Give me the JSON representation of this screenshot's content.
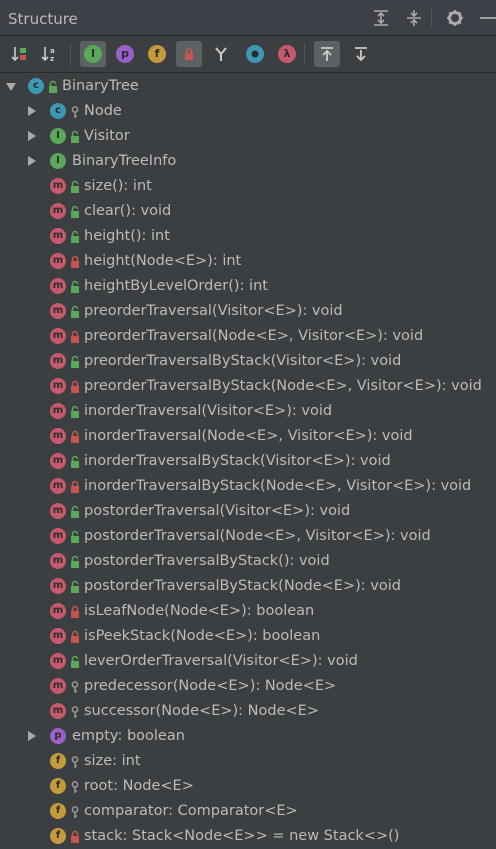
{
  "header": {
    "title": "Structure"
  },
  "toolbar": {
    "buttons": [
      {
        "name": "sort-by-visibility-button",
        "glyph": "↓",
        "active": false
      },
      {
        "name": "sort-alphabetically-button",
        "glyph": "↓",
        "active": false
      },
      {
        "name": "show-inherited-button",
        "glyph": "I",
        "active": true
      },
      {
        "name": "show-properties-button",
        "glyph": "p",
        "active": false
      },
      {
        "name": "show-fields-button",
        "glyph": "f",
        "active": false
      },
      {
        "name": "show-non-public-button",
        "glyph": "",
        "active": true
      },
      {
        "name": "show-anonymous-button",
        "glyph": "Y",
        "active": false
      },
      {
        "name": "show-lambdas-button",
        "glyph": "",
        "active": false
      },
      {
        "name": "show-lambda-button",
        "glyph": "λ",
        "active": false
      },
      {
        "name": "autoscroll-to-source-button",
        "glyph": "",
        "active": true
      },
      {
        "name": "autoscroll-from-source-button",
        "glyph": "",
        "active": false
      }
    ]
  },
  "tree": {
    "items": [
      {
        "label": "BinaryTree",
        "kind": "c",
        "vis": "public",
        "expand": "down",
        "level": 0
      },
      {
        "label": "Node",
        "kind": "c",
        "vis": "package",
        "expand": "right",
        "level": 1
      },
      {
        "label": "Visitor",
        "kind": "i",
        "vis": "public",
        "expand": "right",
        "level": 1
      },
      {
        "label": "BinaryTreeInfo",
        "kind": "i",
        "vis": "none",
        "expand": "right",
        "level": 1
      },
      {
        "label": "size(): int",
        "kind": "m",
        "vis": "public",
        "expand": "none",
        "level": 1
      },
      {
        "label": "clear(): void",
        "kind": "m",
        "vis": "public",
        "expand": "none",
        "level": 1
      },
      {
        "label": "height(): int",
        "kind": "m",
        "vis": "public",
        "expand": "none",
        "level": 1
      },
      {
        "label": "height(Node<E>): int",
        "kind": "m",
        "vis": "private",
        "expand": "none",
        "level": 1
      },
      {
        "label": "heightByLevelOrder(): int",
        "kind": "m",
        "vis": "public",
        "expand": "none",
        "level": 1
      },
      {
        "label": "preorderTraversal(Visitor<E>): void",
        "kind": "m",
        "vis": "public",
        "expand": "none",
        "level": 1
      },
      {
        "label": "preorderTraversal(Node<E>, Visitor<E>): void",
        "kind": "m",
        "vis": "private",
        "expand": "none",
        "level": 1
      },
      {
        "label": "preorderTraversalByStack(Visitor<E>): void",
        "kind": "m",
        "vis": "public",
        "expand": "none",
        "level": 1
      },
      {
        "label": "preorderTraversalByStack(Node<E>, Visitor<E>): void",
        "kind": "m",
        "vis": "private",
        "expand": "none",
        "level": 1
      },
      {
        "label": "inorderTraversal(Visitor<E>): void",
        "kind": "m",
        "vis": "public",
        "expand": "none",
        "level": 1
      },
      {
        "label": "inorderTraversal(Node<E>, Visitor<E>): void",
        "kind": "m",
        "vis": "private",
        "expand": "none",
        "level": 1
      },
      {
        "label": "inorderTraversalByStack(Visitor<E>): void",
        "kind": "m",
        "vis": "public",
        "expand": "none",
        "level": 1
      },
      {
        "label": "inorderTraversalByStack(Node<E>, Visitor<E>): void",
        "kind": "m",
        "vis": "private",
        "expand": "none",
        "level": 1
      },
      {
        "label": "postorderTraversal(Visitor<E>): void",
        "kind": "m",
        "vis": "public",
        "expand": "none",
        "level": 1
      },
      {
        "label": "postorderTraversal(Node<E>, Visitor<E>): void",
        "kind": "m",
        "vis": "public",
        "expand": "none",
        "level": 1
      },
      {
        "label": "postorderTraversalByStack(): void",
        "kind": "m",
        "vis": "public",
        "expand": "none",
        "level": 1
      },
      {
        "label": "postorderTraversalByStack(Node<E>): void",
        "kind": "m",
        "vis": "public",
        "expand": "none",
        "level": 1
      },
      {
        "label": "isLeafNode(Node<E>): boolean",
        "kind": "m",
        "vis": "private",
        "expand": "none",
        "level": 1
      },
      {
        "label": "isPeekStack(Node<E>): boolean",
        "kind": "m",
        "vis": "private",
        "expand": "none",
        "level": 1
      },
      {
        "label": "leverOrderTraversal(Visitor<E>): void",
        "kind": "m",
        "vis": "public",
        "expand": "none",
        "level": 1
      },
      {
        "label": "predecessor(Node<E>): Node<E>",
        "kind": "m",
        "vis": "package",
        "expand": "none",
        "level": 1
      },
      {
        "label": "successor(Node<E>): Node<E>",
        "kind": "m",
        "vis": "package",
        "expand": "none",
        "level": 1
      },
      {
        "label": "empty: boolean",
        "kind": "p",
        "vis": "none",
        "expand": "right",
        "level": 1
      },
      {
        "label": "size: int",
        "kind": "f",
        "vis": "package",
        "expand": "none",
        "level": 1
      },
      {
        "label": "root: Node<E>",
        "kind": "f",
        "vis": "package",
        "expand": "none",
        "level": 1
      },
      {
        "label": "comparator: Comparator<E>",
        "kind": "f",
        "vis": "package",
        "expand": "none",
        "level": 1
      },
      {
        "label": "stack: Stack<Node<E>> = new Stack<>()",
        "kind": "f",
        "vis": "private",
        "expand": "none",
        "level": 1
      }
    ]
  },
  "colors": {
    "public": "#5aa85a",
    "private": "#c75450",
    "package": "#9a9a9a"
  }
}
